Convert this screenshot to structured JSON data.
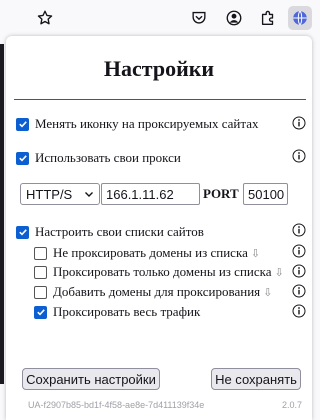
{
  "toolbar": {
    "icons": [
      "star-icon",
      "pocket-icon",
      "account-icon",
      "extensions-icon",
      "proxy-extension-icon"
    ]
  },
  "popup": {
    "title": "Настройки",
    "options": [
      {
        "label": "Менять иконку на проксируемых сайтах",
        "checked": true
      },
      {
        "label": "Использовать свои прокси",
        "checked": true
      }
    ],
    "proxy": {
      "protocol": "HTTP/S",
      "host": "166.1.11.62",
      "port_label": "PORT",
      "port": "50100"
    },
    "custom_lists": {
      "label": "Настроить свои списки сайтов",
      "checked": true
    },
    "sub_options": [
      {
        "label": "Не проксировать домены из списка",
        "checked": false,
        "arrow": "⇩"
      },
      {
        "label": "Проксировать только домены из списка",
        "checked": false,
        "arrow": "⇩"
      },
      {
        "label": "Добавить домены для проксирования",
        "checked": false,
        "arrow": "⇩"
      },
      {
        "label": "Проксировать весь трафик",
        "checked": true,
        "arrow": ""
      }
    ],
    "save_label": "Сохранить настройки",
    "cancel_label": "Не сохранять",
    "user_id": "UA-f2907b85-bd1f-4f58-ae8e-7d411139f34e",
    "version": "2.0.7"
  },
  "colors": {
    "accent": "#0b5fd0",
    "background": "#ffffff",
    "toolbar": "#f9f9fb"
  }
}
